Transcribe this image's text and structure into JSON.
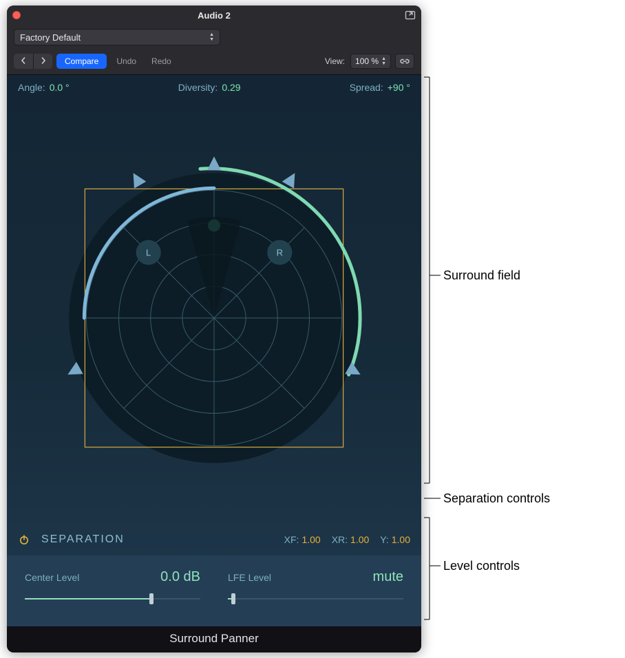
{
  "window": {
    "title": "Audio 2",
    "preset": "Factory Default"
  },
  "toolbar": {
    "compare": "Compare",
    "undo": "Undo",
    "redo": "Redo",
    "view_label": "View:",
    "view_value": "100 %"
  },
  "params": {
    "angle_label": "Angle:",
    "angle_value": "0.0 °",
    "diversity_label": "Diversity:",
    "diversity_value": "0.29",
    "spread_label": "Spread:",
    "spread_value": "+90 °"
  },
  "field": {
    "left_node": "L",
    "right_node": "R"
  },
  "separation": {
    "title": "SEPARATION",
    "xf_label": "XF:",
    "xf_value": "1.00",
    "xr_label": "XR:",
    "xr_value": "1.00",
    "y_label": "Y:",
    "y_value": "1.00"
  },
  "levels": {
    "center_label": "Center Level",
    "center_value": "0.0 dB",
    "center_pos": 0.72,
    "lfe_label": "LFE Level",
    "lfe_value": "mute",
    "lfe_pos": 0.03
  },
  "footer": {
    "name": "Surround Panner"
  },
  "callouts": {
    "field": "Surround field",
    "separation": "Separation controls",
    "levels": "Level controls"
  }
}
